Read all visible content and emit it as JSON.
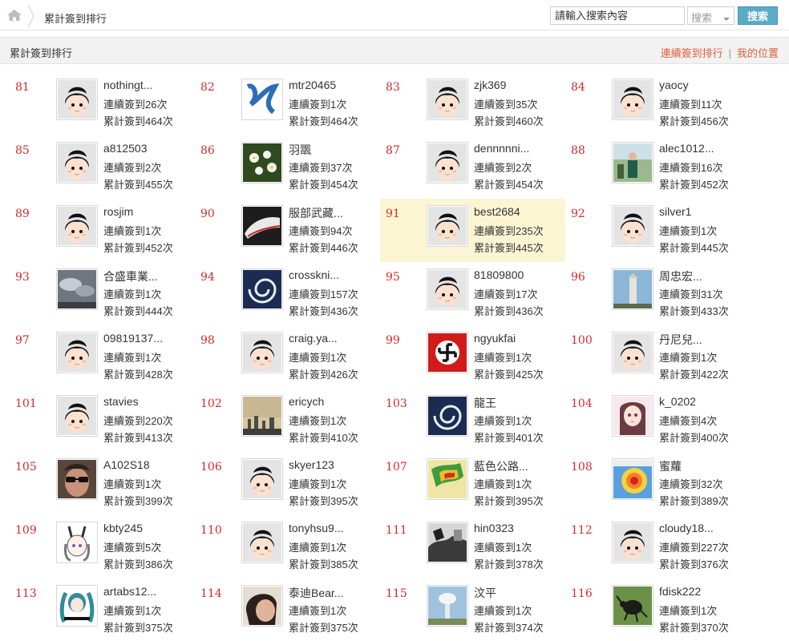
{
  "breadcrumb": {
    "title": "累計簽到排行"
  },
  "search": {
    "placeholder": "請輸入搜索內容",
    "type_label": "搜索",
    "button_label": "搜索"
  },
  "section": {
    "title": "累計簽到排行",
    "link_consecutive": "連續簽到排行",
    "separator": "|",
    "link_my_position": "我的位置"
  },
  "colors": {
    "rank": "#d22b2b",
    "link": "#e0603e",
    "search_button": "#5aaac8",
    "highlight": "#fcf5d4"
  },
  "entries": [
    {
      "rank": "81",
      "name": "nothingt...",
      "consecutive": "連續簽到26次",
      "total": "累計簽到464次",
      "avatar": "default-avatar"
    },
    {
      "rank": "82",
      "name": "mtr20465",
      "consecutive": "連續簽到1次",
      "total": "累計簽到464次",
      "avatar": "blue-brush-avatar"
    },
    {
      "rank": "83",
      "name": "zjk369",
      "consecutive": "連續簽到35次",
      "total": "累計簽到460次",
      "avatar": "default-avatar"
    },
    {
      "rank": "84",
      "name": "yaocy",
      "consecutive": "連續簽到11次",
      "total": "累計簽到456次",
      "avatar": "default-avatar"
    },
    {
      "rank": "85",
      "name": "a812503",
      "consecutive": "連續簽到2次",
      "total": "累計簽到455次",
      "avatar": "default-avatar"
    },
    {
      "rank": "86",
      "name": "羽飁",
      "consecutive": "連續簽到37次",
      "total": "累計簽到454次",
      "avatar": "flowers-avatar"
    },
    {
      "rank": "87",
      "name": "dennnnni...",
      "consecutive": "連續簽到2次",
      "total": "累計簽到454次",
      "avatar": "default-avatar"
    },
    {
      "rank": "88",
      "name": "alec1012...",
      "consecutive": "連續簽到16次",
      "total": "累計簽到452次",
      "avatar": "person-outdoor-avatar"
    },
    {
      "rank": "89",
      "name": "rosjim",
      "consecutive": "連續簽到1次",
      "total": "累計簽到452次",
      "avatar": "default-avatar"
    },
    {
      "rank": "90",
      "name": "服部武藏...",
      "consecutive": "連續簽到94次",
      "total": "累計簽到446次",
      "avatar": "train-avatar"
    },
    {
      "rank": "91",
      "name": "best2684",
      "consecutive": "連續簽到235次",
      "total": "累計簽到445次",
      "avatar": "default-avatar",
      "highlight": true
    },
    {
      "rank": "92",
      "name": "silver1",
      "consecutive": "連續簽到1次",
      "total": "累計簽到445次",
      "avatar": "default-avatar"
    },
    {
      "rank": "93",
      "name": "合盛車業...",
      "consecutive": "連續簽到1次",
      "total": "累計簽到444次",
      "avatar": "cloudy-sky-avatar"
    },
    {
      "rank": "94",
      "name": "crosskni...",
      "consecutive": "連續簽到157次",
      "total": "累計簽到436次",
      "avatar": "typhoon-satellite-avatar"
    },
    {
      "rank": "95",
      "name": "81809800",
      "consecutive": "連續簽到17次",
      "total": "累計簽到436次",
      "avatar": "default-avatar"
    },
    {
      "rank": "96",
      "name": "周忠宏...",
      "consecutive": "連續簽到31次",
      "total": "累計簽到433次",
      "avatar": "tower-avatar"
    },
    {
      "rank": "97",
      "name": "09819137...",
      "consecutive": "連續簽到1次",
      "total": "累計簽到428次",
      "avatar": "default-avatar"
    },
    {
      "rank": "98",
      "name": "craig.ya...",
      "consecutive": "連續簽到1次",
      "total": "累計簽到426次",
      "avatar": "default-avatar"
    },
    {
      "rank": "99",
      "name": "ngyukfai",
      "consecutive": "連續簽到1次",
      "total": "累計簽到425次",
      "avatar": "red-flag-avatar"
    },
    {
      "rank": "100",
      "name": "丹尼兒...",
      "consecutive": "連續簽到1次",
      "total": "累計簽到422次",
      "avatar": "default-avatar"
    },
    {
      "rank": "101",
      "name": "stavies",
      "consecutive": "連續簽到220次",
      "total": "累計簽到413次",
      "avatar": "default-avatar"
    },
    {
      "rank": "102",
      "name": "ericych",
      "consecutive": "連續簽到1次",
      "total": "累計簽到410次",
      "avatar": "city-sunset-avatar"
    },
    {
      "rank": "103",
      "name": "龍王",
      "consecutive": "連續簽到1次",
      "total": "累計簽到401次",
      "avatar": "typhoon-satellite-avatar"
    },
    {
      "rank": "104",
      "name": "k_0202",
      "consecutive": "連續簽到4次",
      "total": "累計簽到400次",
      "avatar": "anime-girl-avatar"
    },
    {
      "rank": "105",
      "name": "A102S18",
      "consecutive": "連續簽到1次",
      "total": "累計簽到399次",
      "avatar": "sunglasses-avatar"
    },
    {
      "rank": "106",
      "name": "skyer123",
      "consecutive": "連續簽到1次",
      "total": "累計簽到395次",
      "avatar": "default-avatar"
    },
    {
      "rank": "107",
      "name": "藍色公路...",
      "consecutive": "連續簽到1次",
      "total": "累計簽到395次",
      "avatar": "radar-map-avatar"
    },
    {
      "rank": "108",
      "name": "蜜蘿",
      "consecutive": "連續簽到32次",
      "total": "累計簽到389次",
      "avatar": "heatmap-avatar"
    },
    {
      "rank": "109",
      "name": "kbty245",
      "consecutive": "連續簽到5次",
      "total": "累計簽到386次",
      "avatar": "anime-bunny-avatar"
    },
    {
      "rank": "110",
      "name": "tonyhsu9...",
      "consecutive": "連續簽到1次",
      "total": "累計簽到385次",
      "avatar": "default-avatar"
    },
    {
      "rank": "111",
      "name": "hin0323",
      "consecutive": "連續簽到1次",
      "total": "累計簽到378次",
      "avatar": "bw-photo-avatar"
    },
    {
      "rank": "112",
      "name": "cloudy18...",
      "consecutive": "連續簽到227次",
      "total": "累計簽到376次",
      "avatar": "default-avatar"
    },
    {
      "rank": "113",
      "name": "artabs12...",
      "consecutive": "連續簽到1次",
      "total": "累計簽到375次",
      "avatar": "anime-twintail-avatar"
    },
    {
      "rank": "114",
      "name": "泰迪Bear...",
      "consecutive": "連續簽到1次",
      "total": "累計簽到375次",
      "avatar": "person-face-avatar"
    },
    {
      "rank": "115",
      "name": "汶平",
      "consecutive": "連續簽到1次",
      "total": "累計簽到374次",
      "avatar": "mushroom-cloud-avatar"
    },
    {
      "rank": "116",
      "name": "fdisk222",
      "consecutive": "連續簽到1次",
      "total": "累計簽到370次",
      "avatar": "beetle-avatar"
    }
  ]
}
